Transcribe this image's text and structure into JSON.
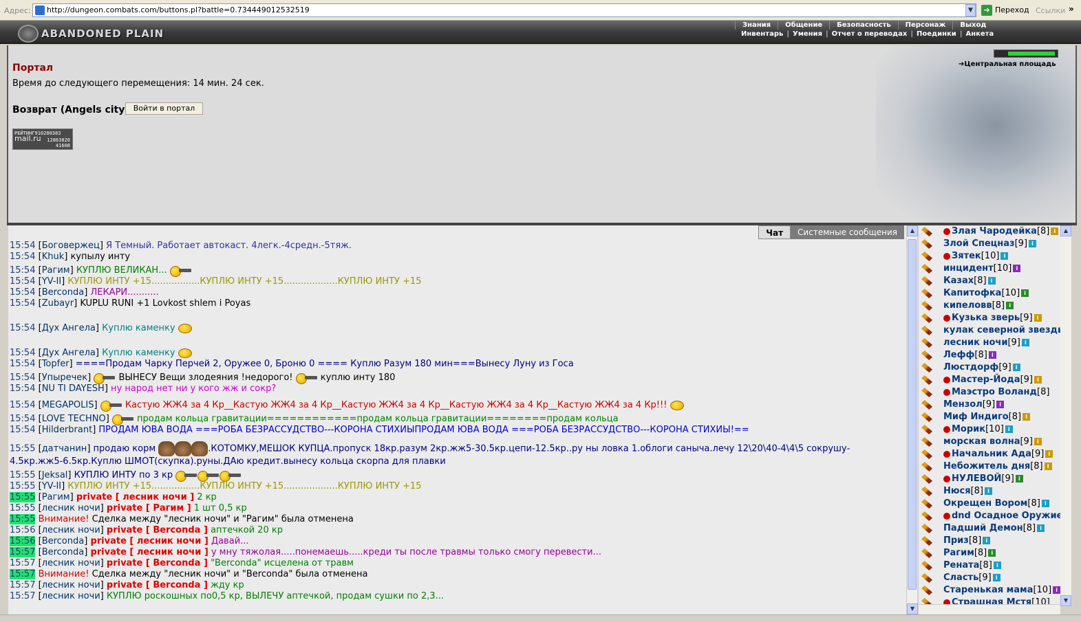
{
  "browser": {
    "address_label": "Адрес:",
    "url": "http://dungeon.combats.com/buttons.pl?battle=0.734449012532519",
    "go_label": "Переход",
    "links_label": "Ссылки",
    "chevron": "»"
  },
  "header": {
    "logo_text": "ABANDONED PLAIN",
    "menu_top": [
      "Знания",
      "Общение",
      "Безопасность",
      "Персонаж",
      "Выход"
    ],
    "menu_bottom": [
      "Инвентарь",
      "Умения",
      "Отчет о переводах",
      "Поединки",
      "Анкета"
    ]
  },
  "portal": {
    "title": "Портал",
    "timer": "Время до следующего перемещения: 14 мин. 24 сек.",
    "return_label": "Возврат (Angels city)",
    "enter_button": "Войти в портал",
    "location": "Центральная площадь"
  },
  "rating": {
    "line1": "РЕЙТИНГ910280383",
    "logo": "mail.ru",
    "num1": "12863820",
    "num2": "41608"
  },
  "chat_tabs": [
    "Чат",
    "Системные сообщения"
  ],
  "chat": [
    {
      "time": "15:54",
      "nick": "Боговержец",
      "text": "Я Темный. Работает автокаст. 4легк.-4средн.-5тяж.",
      "color": "#333399"
    },
    {
      "time": "15:54",
      "nick": "Khuk",
      "text": "купылу инту",
      "color": "#000000"
    },
    {
      "time": "15:54",
      "nick": "Рагим",
      "text": "КУПЛЮ ВЕЛИКАН...",
      "color": "#008000"
    },
    {
      "time": "15:54",
      "nick": "YV-II",
      "text": "КУПЛЮ ИНТУ +15.................КУПЛЮ ИНТУ +15...................КУПЛЮ ИНТУ +15",
      "color": "#999900"
    },
    {
      "time": "15:54",
      "nick": "Berconda",
      "text": "ЛЕКАРИ...........",
      "color": "#990099"
    },
    {
      "time": "15:54",
      "nick": "Zubayr",
      "text": "KUPLU RUNI +1 Lovkost shlem i Poyas",
      "color": "#000000"
    },
    {
      "time": "15:54",
      "nick": "Дух Ангела",
      "text": "Куплю каменку",
      "color": "#008080"
    },
    {
      "time": "15:54",
      "nick": "Дух Ангела",
      "text": "Куплю каменку",
      "color": "#008080"
    },
    {
      "time": "15:54",
      "nick": "Topfer",
      "text": "====Продам Чарку Перчей 2, Оружее 0, Броню 0 ==== Куплю Разум 180 мин===Вынесу Луну из Госа",
      "color": "#000080"
    },
    {
      "time": "15:54",
      "nick": "Упыречек",
      "text": "ВЫНЕСУ Вещи злодеяния !недорого!",
      "text2": "куплю инту 180",
      "color": "#000000"
    },
    {
      "time": "15:54",
      "nick": "NU TI DAYESH",
      "text": "ну народ нет ни у кого жж и сокр?",
      "color": "#cc00cc"
    },
    {
      "time": "15:54",
      "nick": "MEGAPOLIS",
      "text": "Кастую ЖЖ4 за 4 Кр__Кастую ЖЖ4 за 4 Кр__Кастую ЖЖ4 за 4 Кр__Кастую ЖЖ4 за 4 Кр__Кастую ЖЖ4 за 4 Кр!!!",
      "color": "#cc0000"
    },
    {
      "time": "15:54",
      "nick": "LOVE TECHNO",
      "text": "продам кольца гравитации============продам кольца гравитации========продам кольца",
      "color": "#008000"
    },
    {
      "time": "15:54",
      "nick": "Hilderbrant",
      "text": "ПРОДАМ ЮВА ВОДА ===РОБА БЕЗРАССУДСТВО---КОРОНА СТИХИЫПРОДАМ ЮВА ВОДА ===РОБА БЕЗРАССУДСТВО---КОРОНА СТИХИЫ!==",
      "color": "#0000cc"
    },
    {
      "time": "15:55",
      "nick": "датчанин",
      "text": "продаю корм",
      "text2": ".КОТОМКУ,МЕШОК КУПЦА.пропуск 18кр.разум 2кр.жж5-30.5кр.цепи-12.5кр..ру ны ловка 1.облоги саныча.лечу 12\\20\\40-4\\4\\5 сокрушу-",
      "text3": "4.5кр.жж5-6.5кр.Куплю ШМОТ(скупка).руны.ДАю кредит.вынесу кольца скорпа для плавки",
      "color": "#000080"
    },
    {
      "time": "15:55",
      "nick": "Jeksal",
      "text": "КУПЛЮ ИНТУ по 3 кр",
      "color": "#000080"
    },
    {
      "time": "15:55",
      "nick": "YV-II",
      "text": "КУПЛЮ ИНТУ +15.................КУПЛЮ ИНТУ +15...................КУПЛЮ ИНТУ +15",
      "color": "#999900"
    },
    {
      "time": "15:55",
      "nick": "Рагим",
      "private": "private [ лесник ночи ]",
      "text": "2 кр",
      "color": "#008000",
      "highlight": true
    },
    {
      "time": "15:55",
      "nick": "лесник ночи",
      "private": "private [ Рагим ]",
      "text": "1 шт 0,5 кр",
      "color": "#008000"
    },
    {
      "time": "15:55",
      "warning": "Внимание!",
      "text": "Сделка между \"лесник ночи\" и \"Рагим\" была отменена",
      "color": "#000000",
      "highlight": true
    },
    {
      "time": "15:56",
      "nick": "лесник ночи",
      "private": "private [ Berconda ]",
      "text": "аптечкой 20 кр",
      "color": "#008000"
    },
    {
      "time": "15:56",
      "nick": "Berconda",
      "private": "private [ лесник ночи ]",
      "text": "Давай...",
      "color": "#990099",
      "highlight": true
    },
    {
      "time": "15:57",
      "nick": "Berconda",
      "private": "private [ лесник ночи ]",
      "text": "у мну тяжолая.....понемаешь.....креди ты после травмы только смогу перевести...",
      "color": "#990099",
      "highlight": true
    },
    {
      "time": "15:57",
      "nick": "лесник ночи",
      "private": "private [ Berconda ]",
      "text": "\"Berconda\" исцелена от травм",
      "color": "#008000"
    },
    {
      "time": "15:57",
      "warning": "Внимание!",
      "text": "Сделка между \"лесник ночи\" и \"Berconda\" была отменена",
      "color": "#000000",
      "highlight": true
    },
    {
      "time": "15:57",
      "nick": "лесник ночи",
      "private": "private [ Berconda ]",
      "text": "жду кр",
      "color": "#008000"
    },
    {
      "time": "15:57",
      "nick": "лесник ночи",
      "text": "КУПЛЮ роскошных по0,5 кр, ВЫЛЕЧУ аптечкой, продам сушки по 2,3...",
      "color": "#008000"
    }
  ],
  "users": [
    {
      "name": "Злая Чародейка",
      "level": "[8]",
      "badge": "#cc9900",
      "mark": true
    },
    {
      "name": "Злой Спецназ",
      "level": "[9]",
      "badge": "#1aa0c8"
    },
    {
      "name": "Зятек",
      "level": "[10]",
      "badge": "#1aa0c8",
      "mark": true
    },
    {
      "name": "инцидент",
      "level": "[10]",
      "badge": "#8a2ab8"
    },
    {
      "name": "Казах",
      "level": "[8]",
      "badge": "#1aa0c8"
    },
    {
      "name": "Капитофка",
      "level": "[10]",
      "badge": "#2a8a2a"
    },
    {
      "name": "кипеловв",
      "level": "[8]",
      "badge": "#2a8a2a"
    },
    {
      "name": "Кузька зверь",
      "level": "[9]",
      "badge": "#cc9900",
      "mark": true
    },
    {
      "name": "кулак северной звезды",
      "level": "",
      "badge": ""
    },
    {
      "name": "лесник ночи",
      "level": "[9]",
      "badge": "#1aa0c8"
    },
    {
      "name": "Лефф",
      "level": "[8]",
      "badge": "#8a2ab8"
    },
    {
      "name": "Люстдорф",
      "level": "[9]",
      "badge": "#1aa0c8"
    },
    {
      "name": "Мастер-Йода",
      "level": "[9]",
      "badge": "#cc9900",
      "mark": true
    },
    {
      "name": "Маэстро Воланд",
      "level": "[8]",
      "badge": "",
      "mark": true
    },
    {
      "name": "Мензол",
      "level": "[9]",
      "badge": "#8a2ab8"
    },
    {
      "name": "Миф Индиго",
      "level": "[8]",
      "badge": "#cc9900"
    },
    {
      "name": "Морик",
      "level": "[10]",
      "badge": "#1aa0c8",
      "mark": true
    },
    {
      "name": "морская волна",
      "level": "[9]",
      "badge": "#cc9900"
    },
    {
      "name": "Начальник Ада",
      "level": "[9]",
      "badge": "#cc9900",
      "mark": true
    },
    {
      "name": "Небожитель дня",
      "level": "[8]",
      "badge": "#cc9900"
    },
    {
      "name": "НУЛЕВОЙ",
      "level": "[9]",
      "badge": "#2a8a2a",
      "mark": true
    },
    {
      "name": "Нюся",
      "level": "[8]",
      "badge": "#1aa0c8"
    },
    {
      "name": "Окрещен Вором",
      "level": "[8]",
      "badge": "#1aa0c8"
    },
    {
      "name": "dnd Осадное Оружие",
      "level": "",
      "badge": "",
      "mark": true
    },
    {
      "name": "Падший Демон",
      "level": "[8]",
      "badge": "#1aa0c8"
    },
    {
      "name": "Приз",
      "level": "[8]",
      "badge": "#1aa0c8"
    },
    {
      "name": "Рагим",
      "level": "[8]",
      "badge": "#2a8a2a"
    },
    {
      "name": "Рената",
      "level": "[8]",
      "badge": "#1aa0c8"
    },
    {
      "name": "Сласть",
      "level": "[9]",
      "badge": "#1aa0c8"
    },
    {
      "name": "Старенькая мама",
      "level": "[10]",
      "badge": "#8a2ab8"
    },
    {
      "name": "Страшная Мстя",
      "level": "[10]",
      "badge": "",
      "mark": true
    }
  ]
}
